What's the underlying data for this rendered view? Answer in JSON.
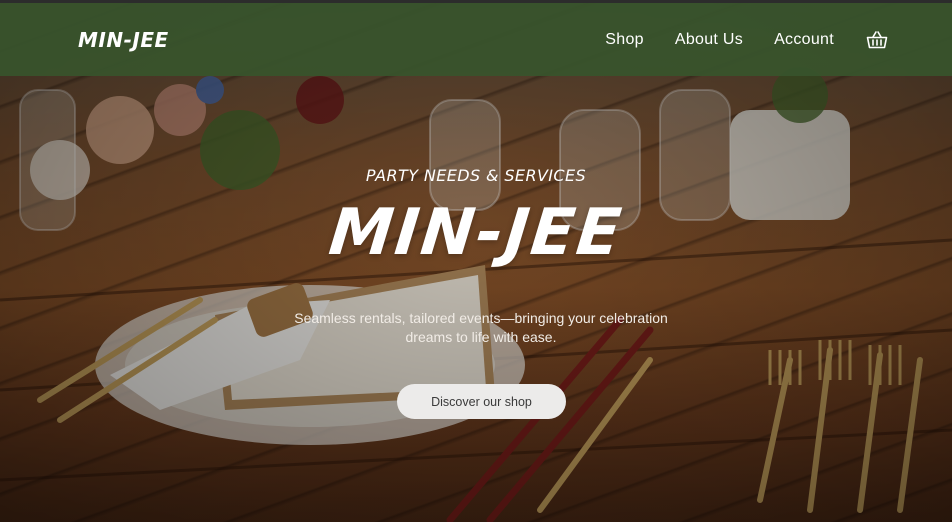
{
  "header": {
    "logo": "MIN-JEE",
    "nav": [
      {
        "label": "Shop"
      },
      {
        "label": "About Us"
      },
      {
        "label": "Account"
      }
    ],
    "cart_icon": "basket-icon"
  },
  "hero": {
    "tagline": "PARTY NEEDS & SERVICES",
    "title": "MIN-JEE",
    "description": "Seamless rentals, tailored events—bringing your celebration dreams to life with ease.",
    "cta_label": "Discover our shop",
    "background": "table-setting-photo"
  },
  "colors": {
    "header_bg": "#38542c",
    "cta_bg": "#ecebea",
    "text": "#ffffff"
  }
}
